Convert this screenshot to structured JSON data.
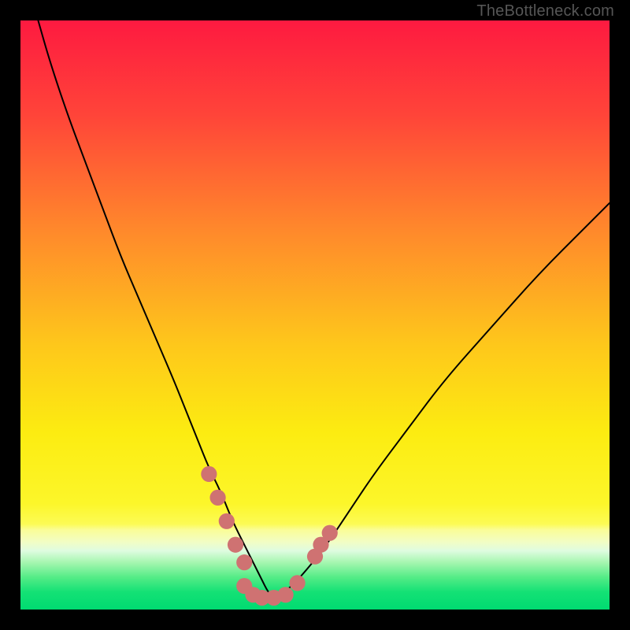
{
  "watermark": {
    "text": "TheBottleneck.com"
  },
  "colors": {
    "black": "#000000",
    "curve": "#000000",
    "marker": "#cf7272",
    "gradient": {
      "top": "#fe1a40",
      "t20": "#ff5138",
      "mid_orange": "#fe9826",
      "yellow": "#fcee11",
      "pale_yellow": "#f9fc8a",
      "pale_green": "#b6f9a7",
      "green_band": "#22e578",
      "bottom_green": "#00db71"
    }
  },
  "chart_data": {
    "type": "line",
    "title": "",
    "xlabel": "",
    "ylabel": "",
    "xlim": [
      0,
      100
    ],
    "ylim": [
      0,
      100
    ],
    "series": [
      {
        "name": "bottleneck-curve",
        "x": [
          3,
          5,
          8,
          11,
          14,
          17,
          20,
          23,
          26,
          28,
          30,
          32,
          34,
          36,
          38,
          40,
          41,
          42,
          43,
          45,
          48,
          52,
          56,
          60,
          66,
          72,
          80,
          88,
          96,
          100
        ],
        "y": [
          100,
          93,
          84,
          76,
          68,
          60,
          53,
          46,
          39,
          34,
          29,
          24,
          20,
          15,
          11,
          7,
          5,
          3,
          2,
          3,
          6,
          11,
          17,
          23,
          31,
          39,
          48,
          57,
          65,
          69
        ]
      }
    ],
    "markers": {
      "name": "highlighted-points",
      "color_ref": "marker",
      "points": [
        {
          "x": 32,
          "y": 23
        },
        {
          "x": 33.5,
          "y": 19
        },
        {
          "x": 35,
          "y": 15
        },
        {
          "x": 36.5,
          "y": 11
        },
        {
          "x": 38,
          "y": 8
        },
        {
          "x": 38,
          "y": 4
        },
        {
          "x": 39.5,
          "y": 2.5
        },
        {
          "x": 41,
          "y": 2
        },
        {
          "x": 43,
          "y": 2
        },
        {
          "x": 45,
          "y": 2.5
        },
        {
          "x": 47,
          "y": 4.5
        },
        {
          "x": 50,
          "y": 9
        },
        {
          "x": 51,
          "y": 11
        },
        {
          "x": 52.5,
          "y": 13
        }
      ]
    },
    "background_bands": [
      {
        "y": 100,
        "color": "#fe1a40"
      },
      {
        "y": 80,
        "color": "#ff5138"
      },
      {
        "y": 55,
        "color": "#fe9826"
      },
      {
        "y": 30,
        "color": "#fcee11"
      },
      {
        "y": 18,
        "color": "#fcf838"
      },
      {
        "y": 14,
        "color": "#f9fc8a"
      },
      {
        "y": 10,
        "color": "#e9fccb"
      },
      {
        "y": 7,
        "color": "#b6f9a7"
      },
      {
        "y": 4,
        "color": "#22e578"
      },
      {
        "y": 0,
        "color": "#00db71"
      }
    ]
  }
}
